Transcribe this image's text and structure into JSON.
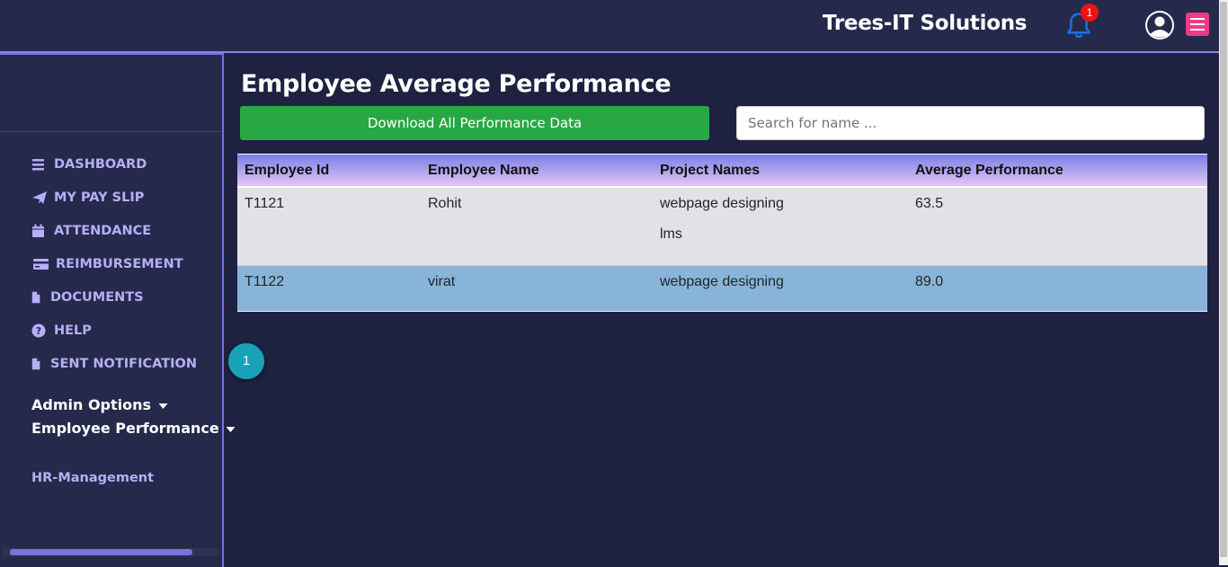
{
  "header": {
    "brand": "Trees-IT Solutions",
    "notification_count": "1"
  },
  "sidebar": {
    "items": [
      {
        "label": "DASHBOARD",
        "icon": "bars-icon"
      },
      {
        "label": "MY PAY SLIP",
        "icon": "paper-plane-icon"
      },
      {
        "label": "ATTENDANCE",
        "icon": "calendar-icon"
      },
      {
        "label": "REIMBURSEMENT",
        "icon": "credit-card-icon"
      },
      {
        "label": "DOCUMENTS",
        "icon": "file-icon"
      },
      {
        "label": "HELP",
        "icon": "question-circle-icon"
      },
      {
        "label": "SENT NOTIFICATION",
        "icon": "file-icon"
      }
    ],
    "admin_options": "Admin Options",
    "employee_performance": "Employee Performance",
    "hr_management": "HR-Management"
  },
  "main": {
    "title": "Employee Average Performance",
    "download_label": "Download All Performance Data",
    "search_placeholder": "Search for name ...",
    "table": {
      "headers": [
        "Employee Id",
        "Employee Name",
        "Project Names",
        "Average Performance"
      ],
      "rows": [
        {
          "id": "T1121",
          "name": "Rohit",
          "projects": [
            "webpage designing",
            "lms"
          ],
          "avg": "63.5"
        },
        {
          "id": "T1122",
          "name": "virat",
          "projects": [
            "webpage designing"
          ],
          "avg": "89.0"
        }
      ]
    },
    "pagination": {
      "current_page": "1"
    }
  },
  "colors": {
    "background": "#1f2141",
    "sidebar_text": "#b8aef5",
    "accent": "#7c6fe0",
    "download_button": "#28a745",
    "page_button": "#17a2b8",
    "badge": "#ee1111"
  }
}
